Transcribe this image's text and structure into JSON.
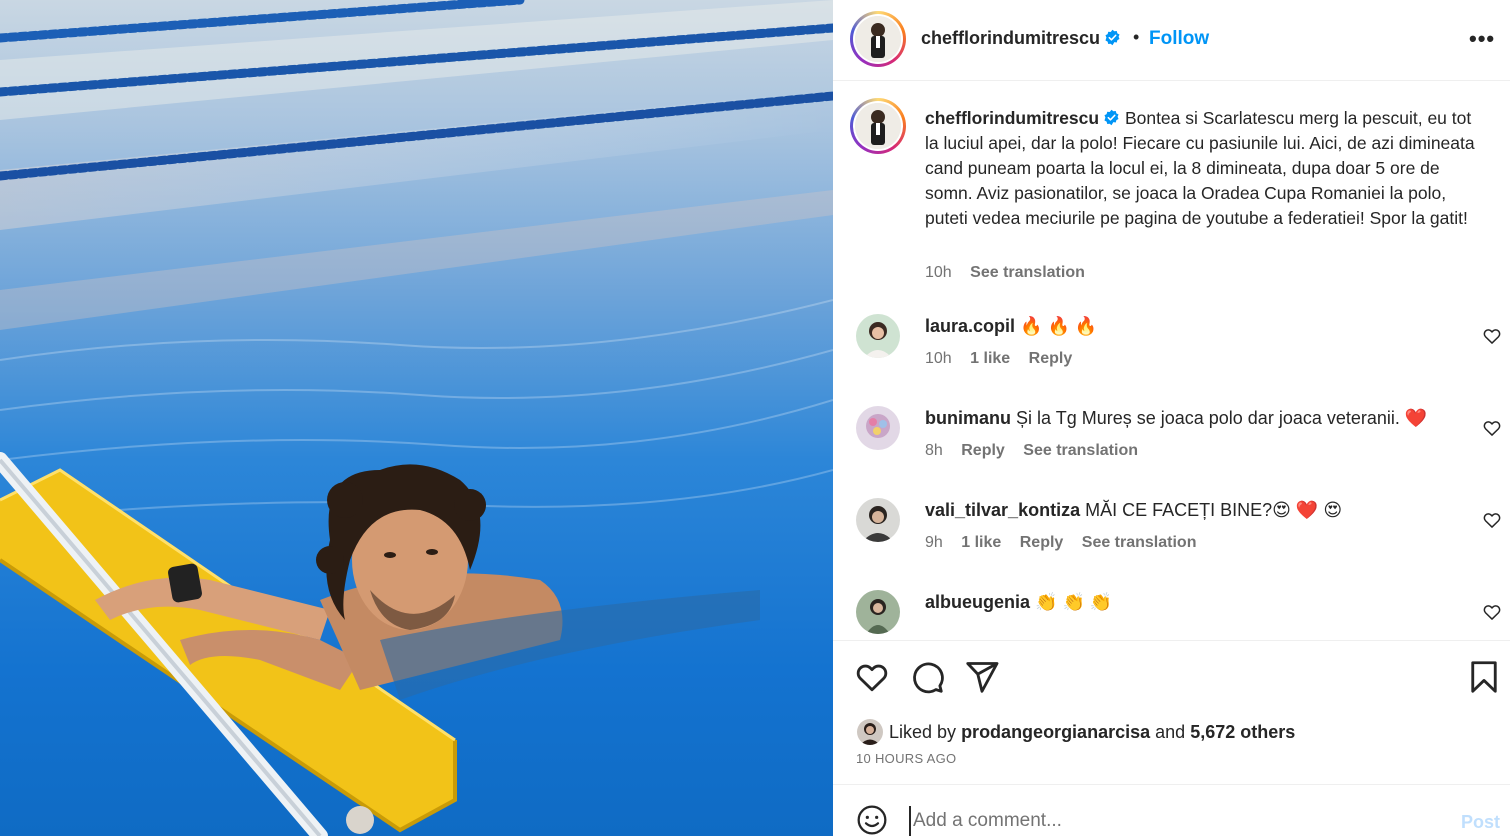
{
  "post": {
    "image_description_icon": "pool-photo",
    "colors": {
      "accent": "#0095f6",
      "text": "#262626",
      "muted": "#737373",
      "verified": "#0095f6",
      "pool": "#1f8de0"
    }
  },
  "header": {
    "username": "chefflorindumitrescu",
    "separator": "•",
    "follow_label": "Follow",
    "more_label": "•••"
  },
  "caption": {
    "username": "chefflorindumitrescu",
    "text": "Bontea si Scarlatescu merg la pescuit, eu tot la luciul apei, dar la polo! Fiecare cu pasiunile lui. Aici, de azi dimineata cand puneam poarta la locul ei, la 8 dimineata, dupa doar 5 ore de somn. Aviz pasionatilor, se joaca la Oradea Cupa Romaniei la polo, puteti vedea meciurile pe pagina de youtube a federatiei! Spor la gatit!",
    "time": "10h",
    "see_translation": "See translation"
  },
  "comments": [
    {
      "username": "laura.copil",
      "text": "🔥 🔥 🔥",
      "time": "10h",
      "likes": "1 like",
      "reply": "Reply",
      "translation": ""
    },
    {
      "username": "bunimanu",
      "text": "Și la Tg Mureș se joaca polo dar joaca veteranii. ❤️",
      "time": "8h",
      "likes": "",
      "reply": "Reply",
      "translation": "See translation"
    },
    {
      "username": "vali_tilvar_kontiza",
      "text": "MĂI CE FACEȚI BINE?😍 ❤️ 😍",
      "time": "9h",
      "likes": "1 like",
      "reply": "Reply",
      "translation": "See translation"
    },
    {
      "username": "albueugenia",
      "text": "👏 👏 👏",
      "time": "",
      "likes": "",
      "reply": "",
      "translation": ""
    }
  ],
  "likes": {
    "prefix": "Liked by",
    "user": "prodangeorgianarcisa",
    "and": "and",
    "others": "5,672 others",
    "time_ago": "10 HOURS AGO"
  },
  "add_comment": {
    "placeholder": "Add a comment...",
    "post_label": "Post"
  }
}
